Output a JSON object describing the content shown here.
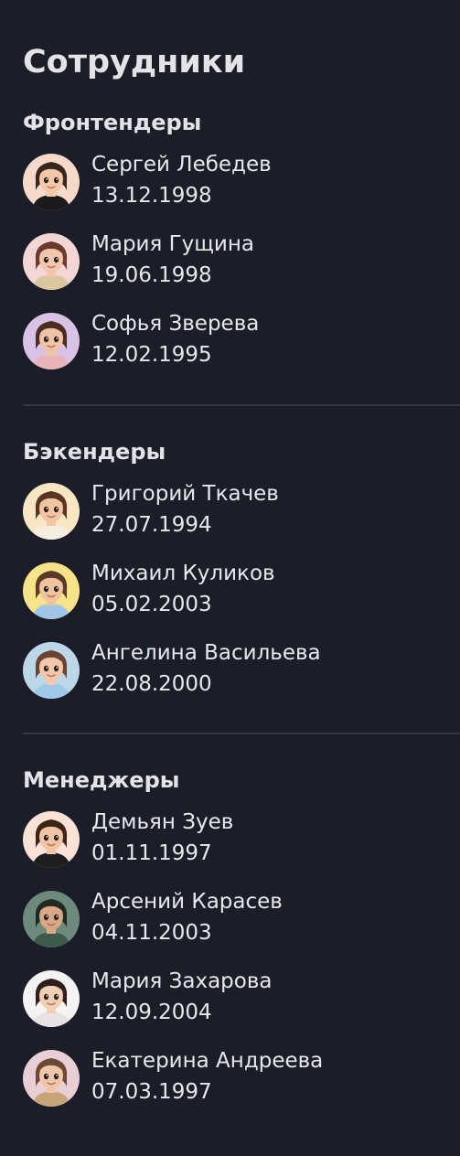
{
  "title": "Сотрудники",
  "sections": [
    {
      "heading": "Фронтендеры",
      "employees": [
        {
          "name": "Сергей Лебедев",
          "birthdate": "13.12.1998",
          "avatar_bg": "#f6d9c8",
          "hair": "#3a2620",
          "shirt": "#1a1a1a",
          "skin": "#f3c8a8"
        },
        {
          "name": "Мария Гущина",
          "birthdate": "19.06.1998",
          "avatar_bg": "#f4d7d4",
          "hair": "#6b3a2a",
          "shirt": "#d9c7a0",
          "skin": "#f2c6ac"
        },
        {
          "name": "Софья Зверева",
          "birthdate": "12.02.1995",
          "avatar_bg": "#d8c3e6",
          "hair": "#4a2c22",
          "shirt": "#e8b4b8",
          "skin": "#efc3a6"
        }
      ]
    },
    {
      "heading": "Бэкендеры",
      "employees": [
        {
          "name": "Григорий Ткачев",
          "birthdate": "27.07.1994",
          "avatar_bg": "#fbe6c4",
          "hair": "#5a3522",
          "shirt": "#f5ede0",
          "skin": "#f2c5a3"
        },
        {
          "name": "Михаил Куликов",
          "birthdate": "05.02.2003",
          "avatar_bg": "#f8e28a",
          "hair": "#5a3a24",
          "shirt": "#9fc6e6",
          "skin": "#f0c49e"
        },
        {
          "name": "Ангелина Васильева",
          "birthdate": "22.08.2000",
          "avatar_bg": "#bcd8e8",
          "hair": "#6a4430",
          "shirt": "#9ec9e8",
          "skin": "#f2c8aa"
        }
      ]
    },
    {
      "heading": "Менеджеры",
      "employees": [
        {
          "name": "Демьян Зуев",
          "birthdate": "01.11.1997",
          "avatar_bg": "#fbe1d6",
          "hair": "#3b2418",
          "shirt": "#1e1e1e",
          "skin": "#f0c4a4"
        },
        {
          "name": "Арсений Карасев",
          "birthdate": "04.11.2003",
          "avatar_bg": "#6e8a7a",
          "hair": "#1f2a24",
          "shirt": "#3e5a4c",
          "skin": "#d9a886"
        },
        {
          "name": "Мария Захарова",
          "birthdate": "12.09.2004",
          "avatar_bg": "#f4f2f2",
          "hair": "#2e1f1a",
          "shirt": "#e6e2e2",
          "skin": "#f2cfb4"
        },
        {
          "name": "Екатерина Андреева",
          "birthdate": "07.03.1997",
          "avatar_bg": "#e8cfd6",
          "hair": "#6a4a36",
          "shirt": "#c8a478",
          "skin": "#f0c6a8"
        }
      ]
    }
  ]
}
